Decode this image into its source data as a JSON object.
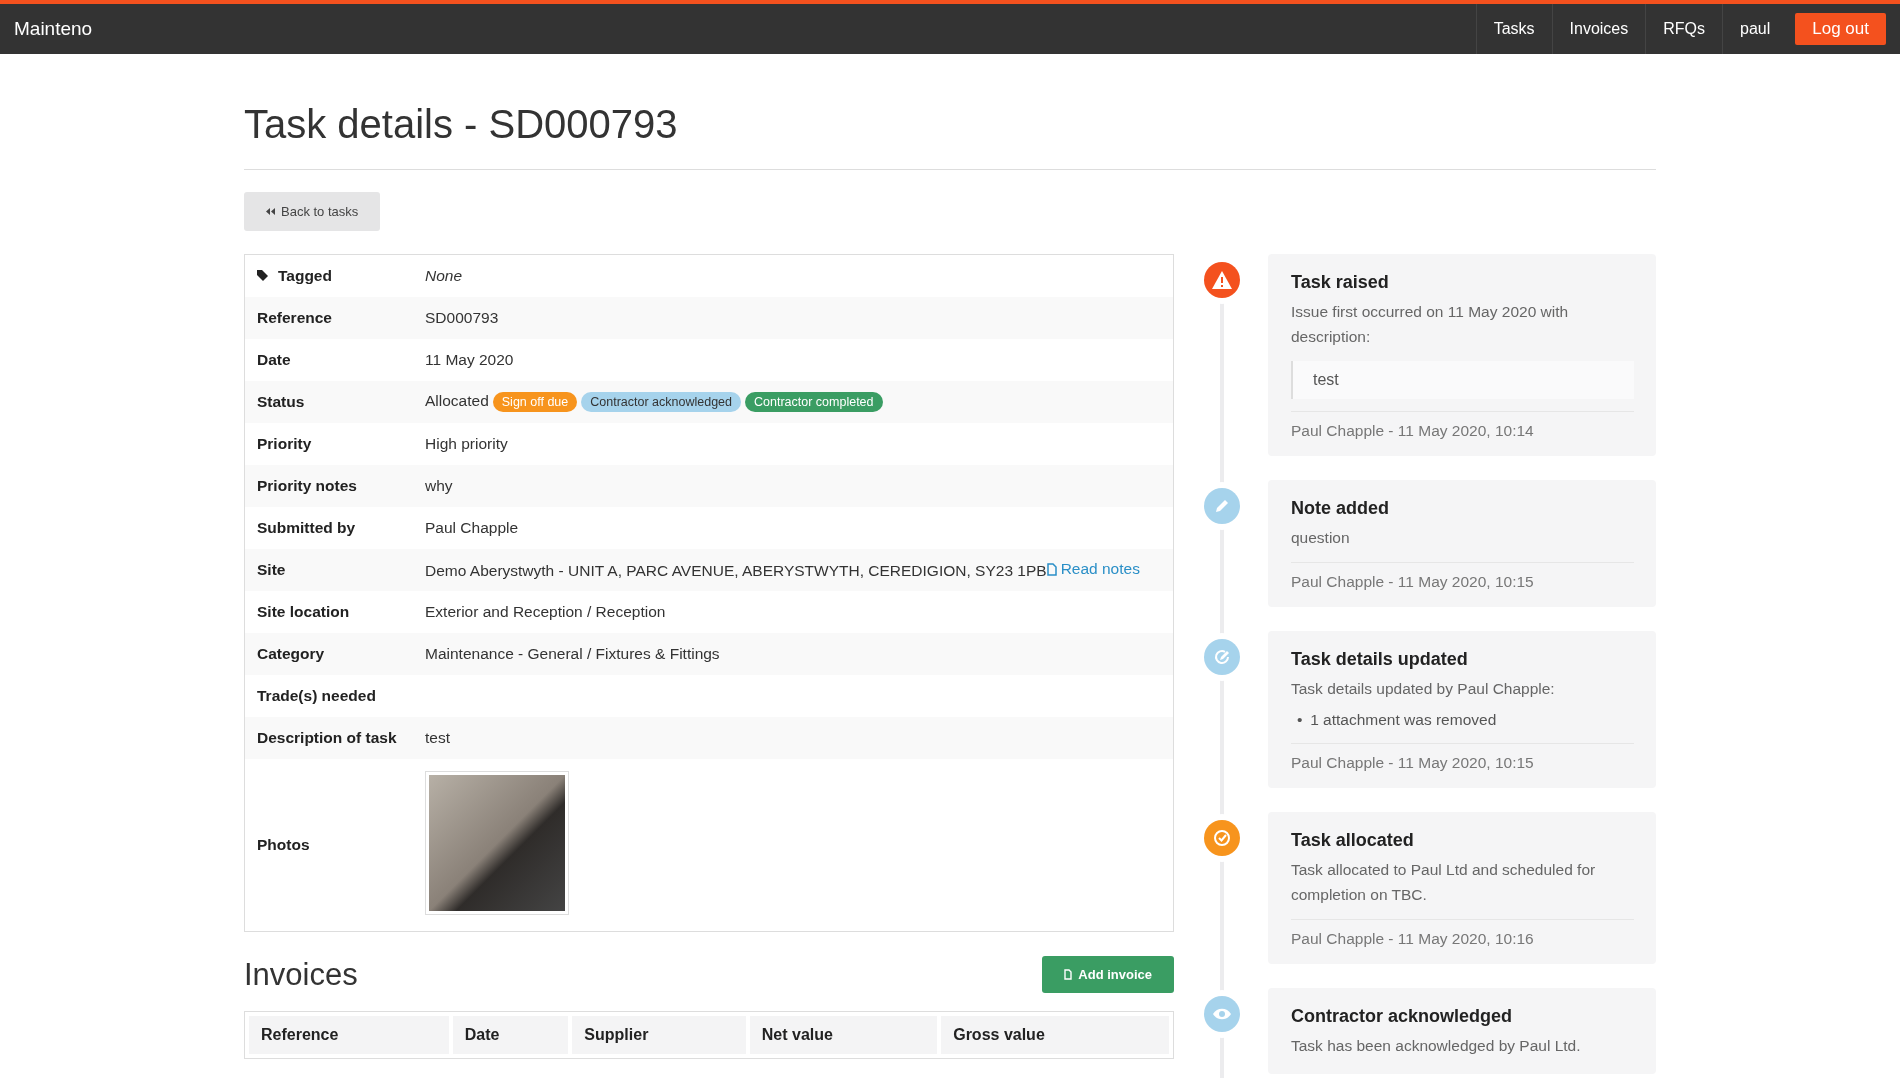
{
  "nav": {
    "brand": "Mainteno",
    "links": [
      {
        "label": "Tasks"
      },
      {
        "label": "Invoices"
      },
      {
        "label": "RFQs"
      },
      {
        "label": "paul"
      }
    ],
    "logout": "Log out"
  },
  "page_title": "Task details - SD000793",
  "back_button": "Back to tasks",
  "details": [
    {
      "kind": "tagged",
      "label": "Tagged",
      "value": "None"
    },
    {
      "kind": "text",
      "label": "Reference",
      "value": "SD000793"
    },
    {
      "kind": "text",
      "label": "Date",
      "value": "11 May 2020"
    },
    {
      "kind": "status",
      "label": "Status",
      "value": "Allocated",
      "badges": [
        {
          "label": "Sign off due",
          "color": "#f7941d"
        },
        {
          "label": "Contractor acknowledged",
          "color": "#a6d3ec"
        },
        {
          "label": "Contractor completed",
          "color": "#3a9d63"
        }
      ]
    },
    {
      "kind": "text",
      "label": "Priority",
      "value": "High priority"
    },
    {
      "kind": "text",
      "label": "Priority notes",
      "value": "why"
    },
    {
      "kind": "text",
      "label": "Submitted by",
      "value": "Paul Chapple"
    },
    {
      "kind": "site",
      "label": "Site",
      "value": "Demo Aberystwyth - UNIT A, PARC AVENUE, ABERYSTWYTH, CEREDIGION, SY23 1PB",
      "link": "Read notes"
    },
    {
      "kind": "text",
      "label": "Site location",
      "value": "Exterior and Reception / Reception"
    },
    {
      "kind": "text",
      "label": "Category",
      "value": "Maintenance - General / Fixtures & Fittings"
    },
    {
      "kind": "empty",
      "label": "Trade(s) needed"
    },
    {
      "kind": "text",
      "label": "Description of task",
      "value": "test"
    },
    {
      "kind": "photo",
      "label": "Photos"
    }
  ],
  "invoices": {
    "heading": "Invoices",
    "add_button": "Add invoice",
    "columns": [
      "Reference",
      "Date",
      "Supplier",
      "Net value",
      "Gross value"
    ]
  },
  "timeline": [
    {
      "kind": "raised",
      "color": "#f4511e",
      "title": "Task raised",
      "text": "Issue first occurred on 11 May 2020 with description:",
      "quote": "test",
      "footer": "Paul Chapple - 11 May 2020, 10:14"
    },
    {
      "kind": "note",
      "color": "#a6d3ec",
      "title": "Note added",
      "text": "question",
      "footer": "Paul Chapple - 11 May 2020, 10:15"
    },
    {
      "kind": "updated",
      "color": "#a6d3ec",
      "title": "Task details updated",
      "text": "Task details updated by Paul Chapple:",
      "bullets": [
        {
          "marker": "•",
          "text": "1 attachment was removed"
        }
      ],
      "footer": "Paul Chapple - 11 May 2020, 10:15"
    },
    {
      "kind": "allocated",
      "color": "#f7941d",
      "title": "Task allocated",
      "text": "Task allocated to Paul Ltd and scheduled for completion on TBC.",
      "footer": "Paul Chapple - 11 May 2020, 10:16"
    },
    {
      "kind": "acknowledged",
      "color": "#a6d3ec",
      "title": "Contractor acknowledged",
      "text": "Task has been acknowledged by Paul Ltd."
    }
  ]
}
